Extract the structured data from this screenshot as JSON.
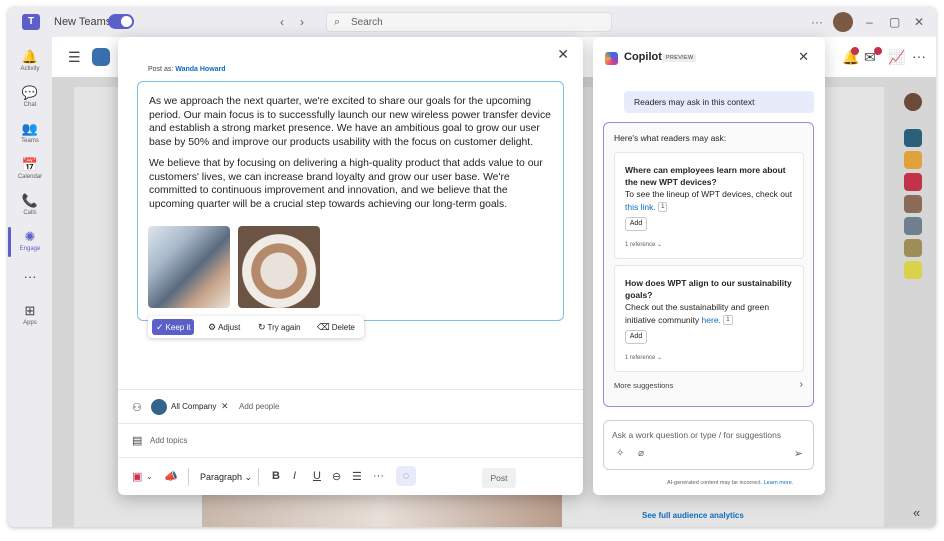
{
  "titlebar": {
    "app_title": "New Teams",
    "search_placeholder": "Search",
    "back_glyph": "‹",
    "forward_glyph": "›",
    "more_glyph": "···",
    "minimize_glyph": "–",
    "maximize_glyph": "▢",
    "close_glyph": "✕"
  },
  "rail": {
    "items": [
      {
        "label": "Activity",
        "icon": "bell-icon",
        "glyph": "🔔"
      },
      {
        "label": "Chat",
        "icon": "chat-icon",
        "glyph": "💬"
      },
      {
        "label": "Teams",
        "icon": "teams-icon",
        "glyph": "👥"
      },
      {
        "label": "Calendar",
        "icon": "calendar-icon",
        "glyph": "📅"
      },
      {
        "label": "Calls",
        "icon": "phone-icon",
        "glyph": "📞"
      },
      {
        "label": "Engage",
        "icon": "engage-icon",
        "glyph": "✺"
      },
      {
        "label": "",
        "icon": "more-icon",
        "glyph": "···"
      },
      {
        "label": "Apps",
        "icon": "apps-icon",
        "glyph": "⊞"
      }
    ]
  },
  "compose": {
    "post_as_prefix": "Post as:",
    "post_as_name": "Wanda Howard",
    "close_glyph": "✕",
    "paragraph1": "As we approach the next quarter, we're excited to share our goals for the upcoming period. Our main focus is to successfully launch our new wireless power transfer device and establish a strong market presence. We have an ambitious goal to grow our user base by 50% and improve our products usability with the focus on customer delight.",
    "paragraph2": "We believe that by focusing on delivering a high-quality product that adds value to our customers' lives, we can increase brand loyalty and grow our user base. We're committed to continuous improvement and innovation, and we believe that the upcoming quarter will be a crucial step towards achieving our long-term goals.",
    "ai_actions": {
      "keep": "Keep it",
      "adjust": "Adjust",
      "try_again": "Try again",
      "delete": "Delete"
    },
    "audience_chip": "All Company",
    "add_people": "Add people",
    "add_topics": "Add topics",
    "toolbar": {
      "paragraph": "Paragraph",
      "bold": "B",
      "italic": "I",
      "underline": "U",
      "link": "⊖",
      "list": "☰",
      "more": "···",
      "post": "Post"
    }
  },
  "copilot": {
    "title": "Copilot",
    "badge": "PREVIEW",
    "close_glyph": "✕",
    "context": "Readers may ask in this context",
    "heading": "Here's what readers may ask:",
    "questions": [
      {
        "title": "Where can employees learn more about the new WPT devices?",
        "body": "To see the lineup of WPT devices, check out",
        "link": "this link.",
        "cite": "1",
        "add": "Add",
        "reference": "1 reference"
      },
      {
        "title": "How does WPT align to our sustainability goals?",
        "body": "Check out the sustainability and green initiative community",
        "link": "here.",
        "cite": "1",
        "add": "Add",
        "reference": "1 reference"
      }
    ],
    "more_suggestions": "More suggestions",
    "input_placeholder": "Ask a work question or type / for suggestions",
    "disclaimer": "AI-generated content may be incorrect.",
    "disclaimer_link": "Learn more."
  },
  "background": {
    "analytics_link": "See full audience analytics"
  },
  "colors": {
    "accent": "#5b5fc7",
    "link": "#0f6cbd",
    "editor_border": "#7bc1e6",
    "copilot_card_border": "#9b8ee0"
  }
}
